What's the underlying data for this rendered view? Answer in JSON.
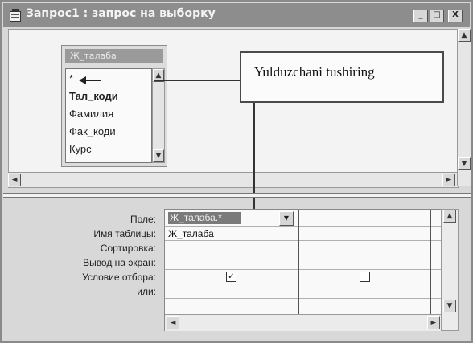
{
  "window": {
    "title": "Запрос1 : запрос на выборку",
    "controls": {
      "minimize": "_",
      "maximize": "□",
      "close": "X"
    }
  },
  "field_list": {
    "table_name": "Ж_талаба",
    "fields": [
      "*",
      "Тал_коди",
      "Фамилия",
      "Фак_коди",
      "Курс"
    ]
  },
  "callout": {
    "text": "Yulduzchani tushiring"
  },
  "grid": {
    "row_labels": {
      "field": "Поле:",
      "table": "Имя таблицы:",
      "sort": "Сортировка:",
      "show": "Вывод на экран:",
      "criteria": "Условие отбора:",
      "or": "или:"
    },
    "columns": [
      {
        "field": "Ж_талаба.*",
        "table": "Ж_талаба",
        "show": true
      },
      {
        "field": "",
        "table": "",
        "show": false
      }
    ]
  },
  "icons": [
    "query-window-icon",
    "drag-arrow-icon"
  ]
}
